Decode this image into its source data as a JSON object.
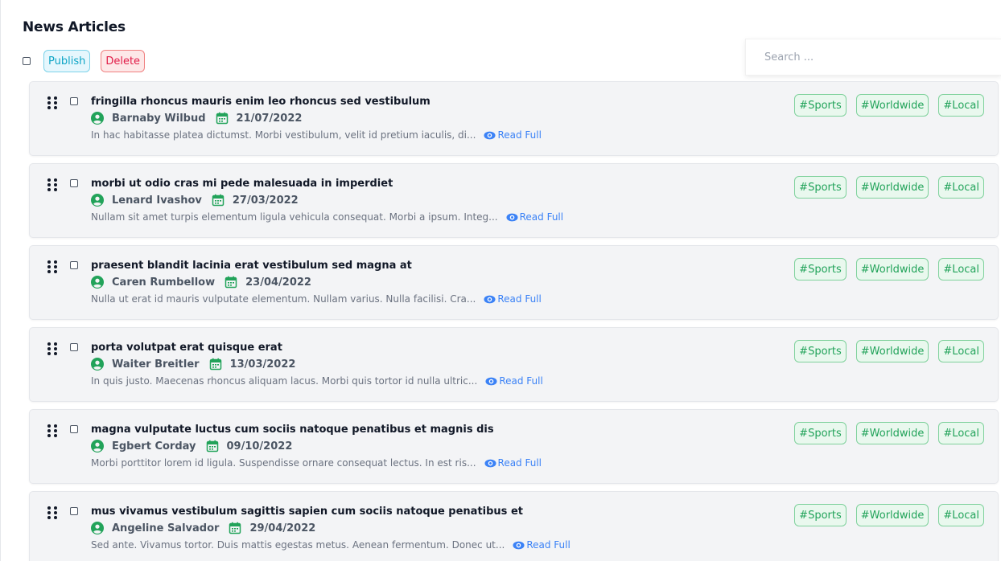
{
  "page": {
    "title": "News Articles"
  },
  "toolbar": {
    "publish_label": "Publish",
    "delete_label": "Delete"
  },
  "search": {
    "placeholder": "Search ..."
  },
  "articles": [
    {
      "title": "fringilla rhoncus mauris enim leo rhoncus sed vestibulum",
      "author": "Barnaby Wilbud",
      "date": "21/07/2022",
      "excerpt": "In hac habitasse platea dictumst. Morbi vestibulum, velit id pretium iaculis, di...",
      "read_full": "Read Full",
      "tags": [
        "#Sports",
        "#Worldwide",
        "#Local"
      ]
    },
    {
      "title": "morbi ut odio cras mi pede malesuada in imperdiet",
      "author": "Lenard Ivashov",
      "date": "27/03/2022",
      "excerpt": "Nullam sit amet turpis elementum ligula vehicula consequat. Morbi a ipsum. Integ...",
      "read_full": "Read Full",
      "tags": [
        "#Sports",
        "#Worldwide",
        "#Local"
      ]
    },
    {
      "title": "praesent blandit lacinia erat vestibulum sed magna at",
      "author": "Caren Rumbellow",
      "date": "23/04/2022",
      "excerpt": "Nulla ut erat id mauris vulputate elementum. Nullam varius. Nulla facilisi. Cra...",
      "read_full": "Read Full",
      "tags": [
        "#Sports",
        "#Worldwide",
        "#Local"
      ]
    },
    {
      "title": "porta volutpat erat quisque erat",
      "author": "Waiter Breitler",
      "date": "13/03/2022",
      "excerpt": "In quis justo. Maecenas rhoncus aliquam lacus. Morbi quis tortor id nulla ultric...",
      "read_full": "Read Full",
      "tags": [
        "#Sports",
        "#Worldwide",
        "#Local"
      ]
    },
    {
      "title": "magna vulputate luctus cum sociis natoque penatibus et magnis dis",
      "author": "Egbert Corday",
      "date": "09/10/2022",
      "excerpt": "Morbi porttitor lorem id ligula. Suspendisse ornare consequat lectus. In est ris...",
      "read_full": "Read Full",
      "tags": [
        "#Sports",
        "#Worldwide",
        "#Local"
      ]
    },
    {
      "title": "mus vivamus vestibulum sagittis sapien cum sociis natoque penatibus et",
      "author": "Angeline Salvador",
      "date": "29/04/2022",
      "excerpt": "Sed ante. Vivamus tortor. Duis mattis egestas metus. Aenean fermentum. Donec ut...",
      "read_full": "Read Full",
      "tags": [
        "#Sports",
        "#Worldwide",
        "#Local"
      ]
    }
  ],
  "colors": {
    "author_icon": "#22a35a",
    "date_icon": "#22a35a",
    "read_full": "#3b82f6",
    "publish": "#0ea5c6",
    "delete": "#e11d48"
  },
  "icons": {
    "drag": "drag-handle-icon",
    "author": "user-circle-icon",
    "date": "calendar-icon",
    "read": "eye-icon"
  }
}
